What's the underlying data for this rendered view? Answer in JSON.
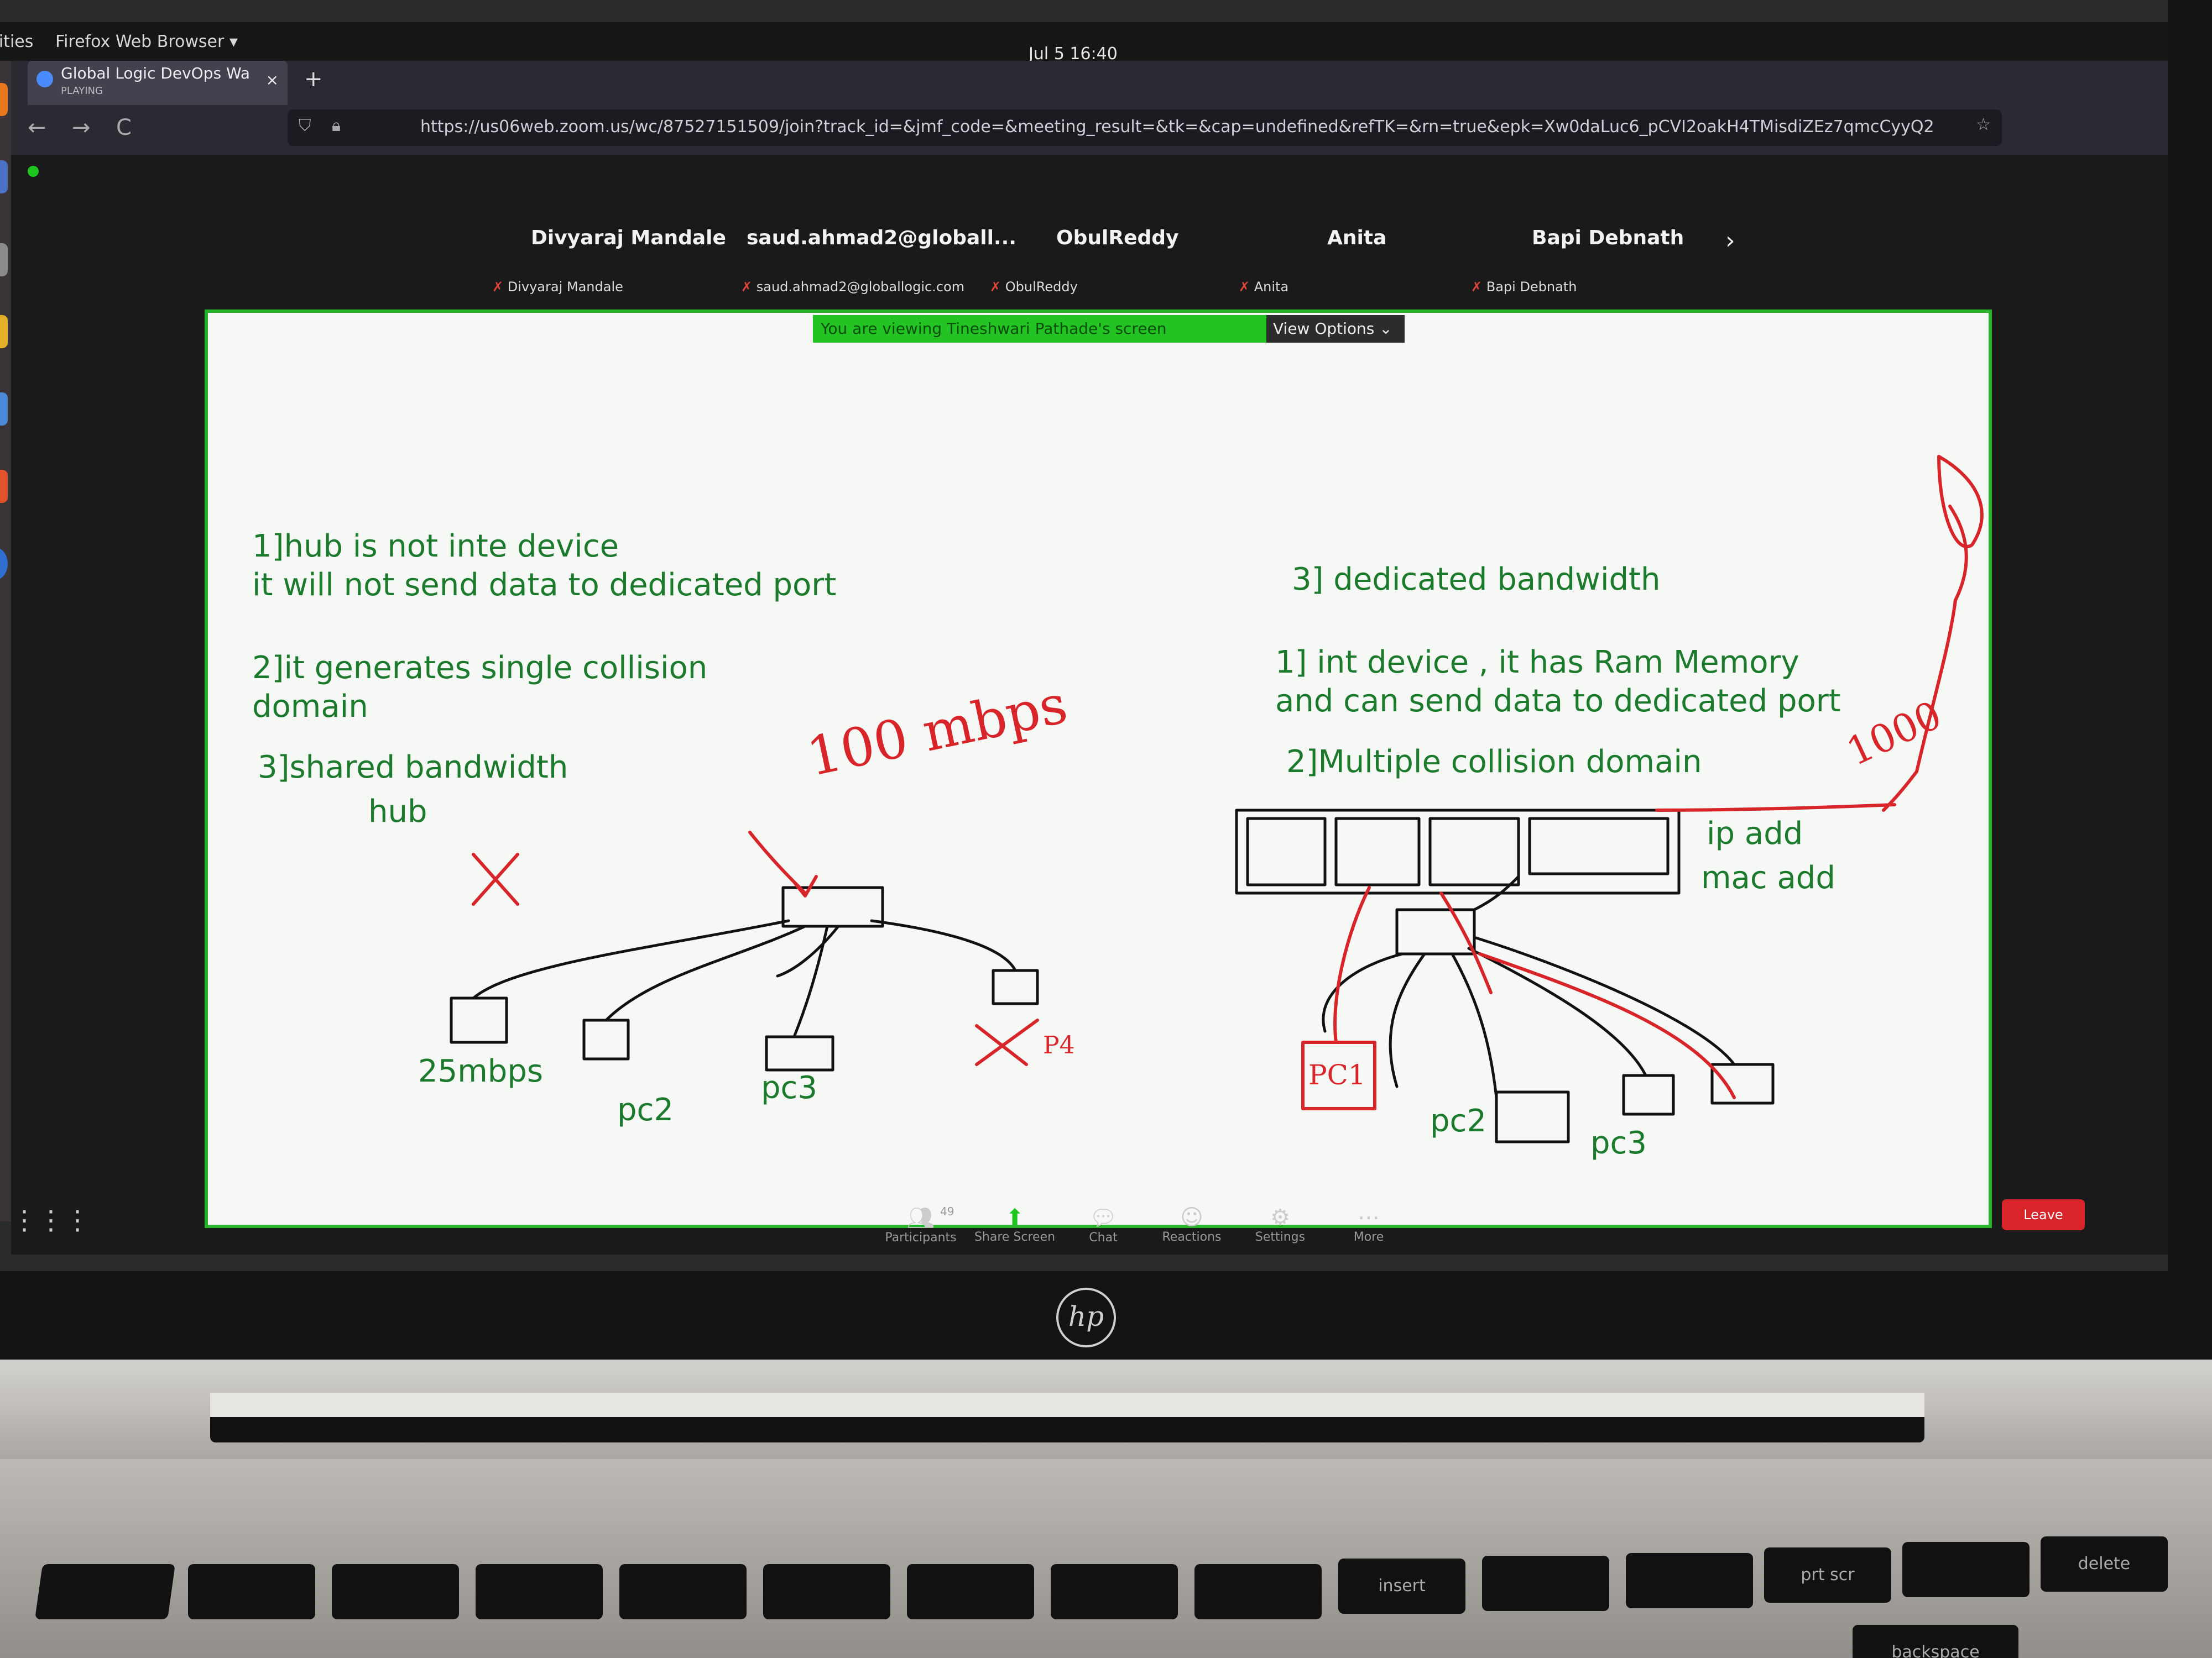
{
  "system": {
    "activities": "tivities",
    "app_menu": "Firefox Web Browser ▾",
    "clock": "Jul 5  16:40"
  },
  "browser": {
    "tab_title": "Global Logic DevOps Wa",
    "tab_sub": "PLAYING",
    "tab_close": "×",
    "new_tab": "+",
    "url": "https://us06web.zoom.us/wc/87527151509/join?track_id=&jmf_code=&meeting_result=&tk=&cap=undefined&refTK=&rn=true&epk=Xw0daLuc6_pCVI2oakH4TMisdiZEz7qmcCyyQ2",
    "back": "←",
    "forward": "→",
    "reload": "C"
  },
  "zoom": {
    "participants": [
      {
        "name": "Divyaraj Mandale",
        "sub": "Divyaraj Mandale"
      },
      {
        "name": "saud.ahmad2@globall...",
        "sub": "saud.ahmad2@globallogic.com"
      },
      {
        "name": "ObulReddy",
        "sub": "ObulReddy"
      },
      {
        "name": "Anita",
        "sub": "Anita"
      },
      {
        "name": "Bapi Debnath",
        "sub": "Bapi Debnath"
      }
    ],
    "next": "›",
    "viewing_banner": "You are viewing Tineshwari Pathade's screen",
    "view_options": "View Options ⌄",
    "toolbar": {
      "participants": "Participants",
      "participants_count": "49",
      "share_screen": "Share Screen",
      "chat": "Chat",
      "reactions": "Reactions",
      "settings": "Settings",
      "more": "More",
      "leave": "Leave"
    }
  },
  "whiteboard": {
    "hub_notes": {
      "line1": "1]hub is not inte device",
      "line1b": "it will not send data to dedicated port",
      "line2": "2]it generates single collision",
      "line2b": "domain",
      "line3": "3]shared bandwidth",
      "hub": "hub"
    },
    "switch_notes": {
      "line3": "3] dedicated bandwidth",
      "line1": "1] int device , it has Ram Memory",
      "line1b": "and can send data to dedicated port",
      "line2": "2]Multiple  collision domain",
      "ip": "ip add",
      "mac": "mac add"
    },
    "hub_pcs": {
      "pc1": "25mbps",
      "pc2": "pc2",
      "pc3": "pc3"
    },
    "switch_pcs": {
      "pc2": "pc2",
      "pc3": "pc3"
    },
    "red": {
      "speed": "100 mbps",
      "speed2": "1000",
      "p4": "P4",
      "pc1": "PC1"
    }
  },
  "laptop": {
    "logo": "hp",
    "keys": [
      "",
      "",
      "",
      "",
      "",
      "",
      "",
      "",
      "",
      "insert",
      "",
      "",
      "prt scr",
      "",
      "delete"
    ],
    "bottom_keys": [
      "backspace"
    ]
  }
}
